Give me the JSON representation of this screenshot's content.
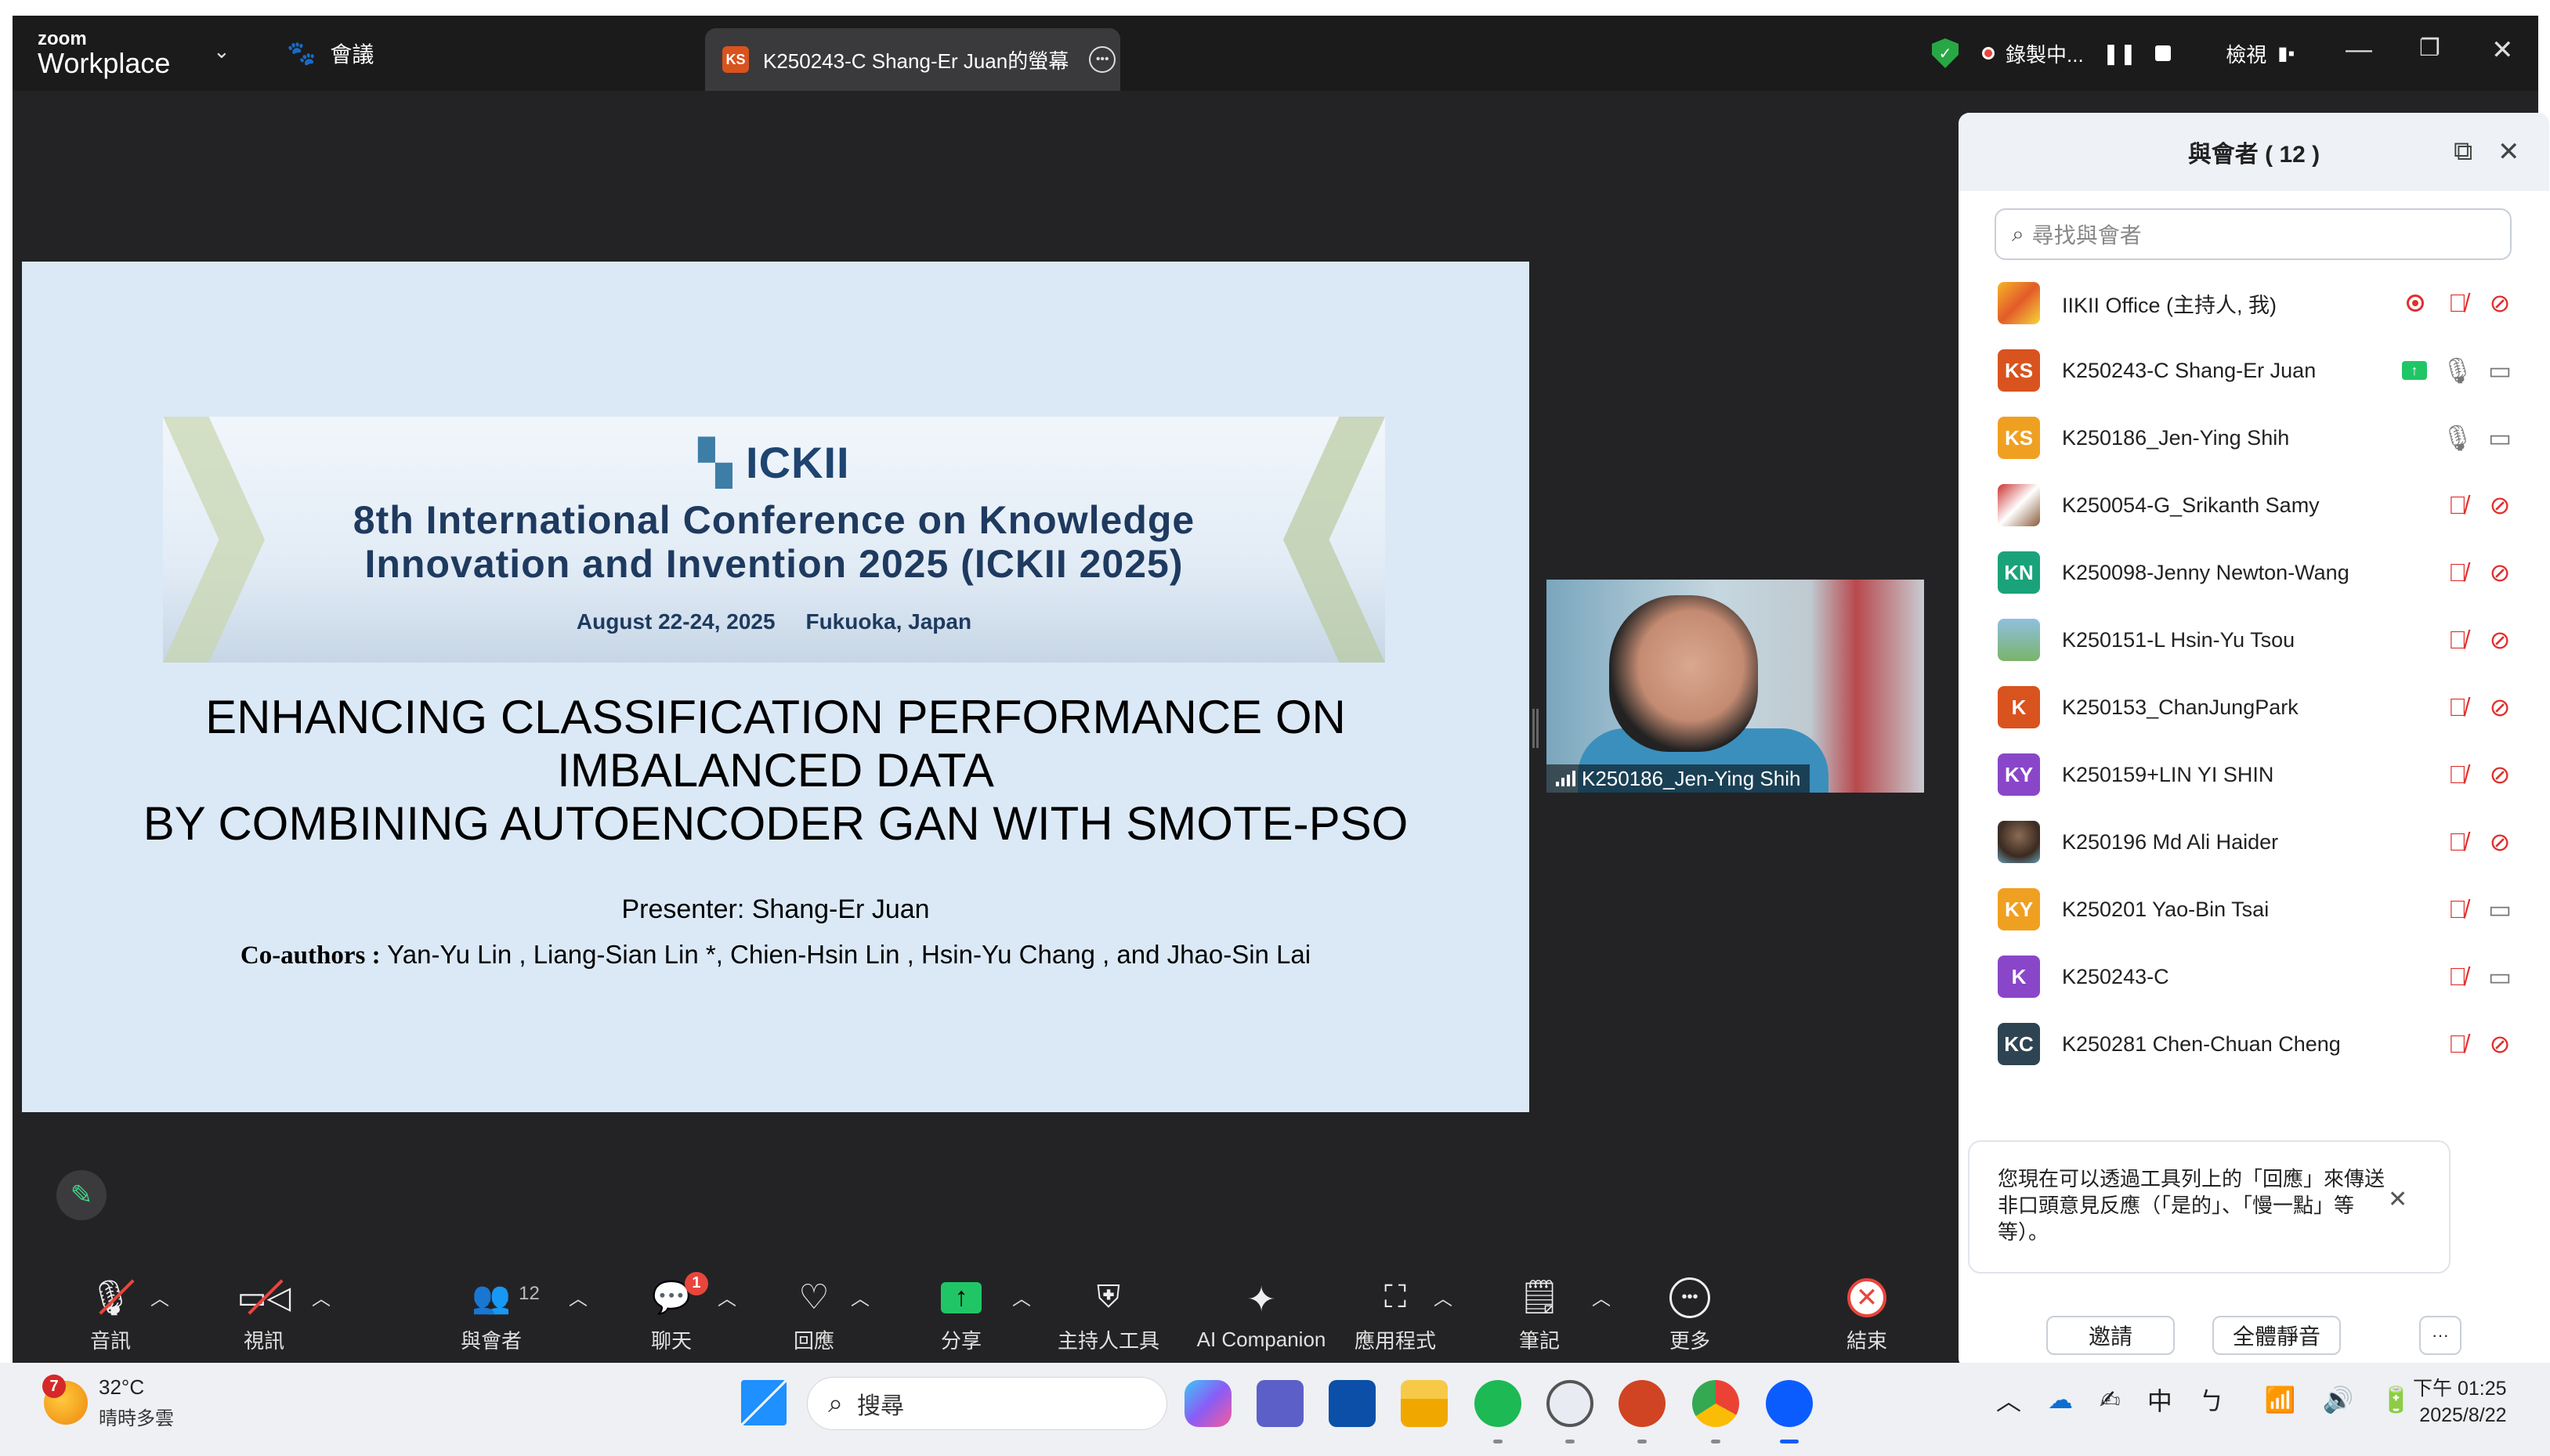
{
  "titlebar": {
    "logo_small": "zoom",
    "logo_big": "Workplace",
    "meeting_label": "會議",
    "share_tab_avatar": "KS",
    "share_tab_title": "K250243-C Shang-Er Juan的螢幕",
    "recording_label": "錄製中...",
    "view_label": "檢視"
  },
  "slide": {
    "logo": "ICKII",
    "conference_line1": "8th International Conference on Knowledge",
    "conference_line2": "Innovation and Invention 2025 (ICKII 2025)",
    "date_location": "August 22-24, 2025     Fukuoka, Japan",
    "paper_title_line1": "ENHANCING CLASSIFICATION PERFORMANCE ON",
    "paper_title_line2": "IMBALANCED DATA",
    "paper_title_line3": "BY COMBINING AUTOENCODER GAN WITH SMOTE-PSO",
    "presenter": "Presenter: Shang-Er Juan",
    "coauthors_label": "Co-authors :",
    "coauthors": " Yan-Yu Lin , Liang-Sian Lin *, Chien-Hsin Lin , Hsin-Yu Chang , and Jhao-Sin Lai"
  },
  "video": {
    "name": "K250186_Jen-Ying Shih"
  },
  "toolbar": {
    "audio": "音訊",
    "video": "視訊",
    "participants": "與會者",
    "participants_count": "12",
    "chat": "聊天",
    "chat_badge": "1",
    "reactions": "回應",
    "share": "分享",
    "host_tools": "主持人工具",
    "ai_companion": "AI Companion",
    "apps": "應用程式",
    "notes": "筆記",
    "more": "更多",
    "end": "結束"
  },
  "panel": {
    "title": "與會者 ( 12 )",
    "search_placeholder": "尋找與會者",
    "participants": [
      {
        "name": "IIKII Office (主持人, 我)",
        "avatar": "",
        "color": "#f0a020"
      },
      {
        "name": "K250243-C Shang-Er Juan",
        "avatar": "KS",
        "color": "#d9531e"
      },
      {
        "name": "K250186_Jen-Ying Shih",
        "avatar": "KS",
        "color": "#f0a020"
      },
      {
        "name": "K250054-G_Srikanth Samy",
        "avatar": "",
        "color": "#c33"
      },
      {
        "name": "K250098-Jenny Newton-Wang",
        "avatar": "KN",
        "color": "#1aa37a"
      },
      {
        "name": "K250151-L Hsin-Yu Tsou",
        "avatar": "",
        "color": "#7bb36a"
      },
      {
        "name": "K250153_ChanJungPark",
        "avatar": "K",
        "color": "#d9531e"
      },
      {
        "name": "K250159+LIN YI SHIN",
        "avatar": "KY",
        "color": "#8a46c9"
      },
      {
        "name": "K250196 Md Ali Haider",
        "avatar": "",
        "color": "#8a6b55"
      },
      {
        "name": "K250201 Yao-Bin Tsai",
        "avatar": "KY",
        "color": "#f0a020"
      },
      {
        "name": "K250243-C",
        "avatar": "K",
        "color": "#8a46c9"
      },
      {
        "name": "K250281 Chen-Chuan Cheng",
        "avatar": "KC",
        "color": "#2f4452"
      }
    ],
    "tip": "您現在可以透過工具列上的「回應」來傳送非口頭意見反應（「是的」、「慢一點」等等）。",
    "invite": "邀請",
    "mute_all": "全體靜音",
    "more": "···"
  },
  "taskbar": {
    "weather_badge": "7",
    "temperature": "32°C",
    "condition": "晴時多雲",
    "search": "搜尋",
    "ime": "中",
    "time": "下午 01:25",
    "date": "2025/8/22"
  }
}
